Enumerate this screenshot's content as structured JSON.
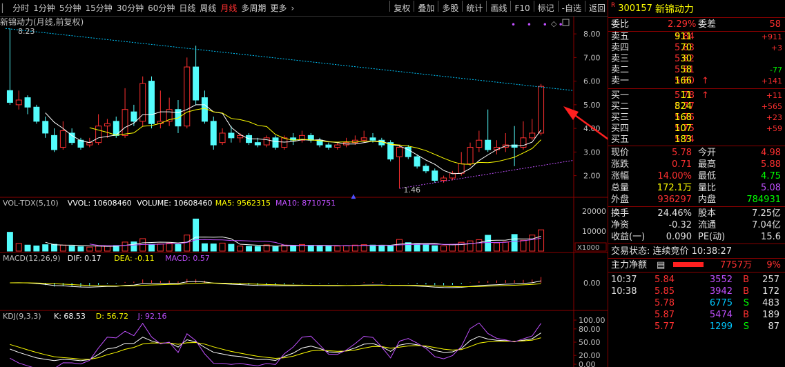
{
  "toolbar": {
    "items": [
      "分时",
      "1分钟",
      "5分钟",
      "15分钟",
      "30分钟",
      "60分钟",
      "日线",
      "周线",
      "月线",
      "多周期",
      "更多"
    ],
    "active": "月线",
    "more_arrow": "›",
    "right": [
      "复权",
      "叠加",
      "多股",
      "统计",
      "画线",
      "F10",
      "标记",
      "-自选",
      "返回"
    ]
  },
  "chart": {
    "title": "新锦动力(月线,前复权)",
    "price_axis": [
      "8.00",
      "7.00",
      "6.00",
      "5.00",
      "4.00",
      "3.00",
      "2.00"
    ],
    "high_label": "8.23",
    "low_label": "1.46",
    "vol_header": [
      "VOL-TDX(5,10)",
      "VVOL: 10608460",
      "VOLUME: 10608460",
      "MA5: 9562315",
      "MA10: 8710751"
    ],
    "vol_axis": [
      "20000",
      "10000"
    ],
    "vol_unit": "X1000",
    "macd_header": [
      "MACD(12,26,9)",
      "DIF: 0.17",
      "DEA: -0.11",
      "MACD: 0.57"
    ],
    "macd_axis": [
      "0.00"
    ],
    "kdj_header": [
      "KDJ(9,3,3)",
      "K: 68.53",
      "D: 56.72",
      "J: 92.16"
    ],
    "kdj_axis": [
      "100.00",
      "80.00",
      "50.00",
      "20.00",
      "0.00"
    ],
    "colors": {
      "up": "#ff3030",
      "down": "#54fcfc",
      "ma5": "#ffffff",
      "ma10": "#ffff00",
      "trend": "#00c8ff",
      "support": "#c050ff"
    }
  },
  "chart_data": {
    "type": "candlestick",
    "note_ignore": false,
    "candles": [
      [
        5.6,
        5.1,
        8.23,
        5.0
      ],
      [
        5.0,
        5.2,
        5.6,
        4.8
      ],
      [
        5.3,
        4.9,
        5.4,
        4.6
      ],
      [
        4.9,
        4.3,
        5.0,
        4.2
      ],
      [
        4.3,
        3.8,
        4.5,
        3.6
      ],
      [
        3.7,
        3.1,
        4.0,
        3.0
      ],
      [
        3.2,
        3.9,
        4.3,
        3.1
      ],
      [
        3.8,
        3.4,
        4.0,
        3.3
      ],
      [
        3.5,
        3.2,
        3.6,
        3.1
      ],
      [
        3.3,
        3.4,
        3.6,
        3.2
      ],
      [
        3.4,
        4.1,
        4.6,
        3.3
      ],
      [
        4.1,
        4.2,
        4.4,
        3.6
      ],
      [
        4.3,
        3.7,
        4.5,
        3.6
      ],
      [
        3.7,
        4.8,
        5.7,
        3.6
      ],
      [
        4.7,
        4.3,
        5.0,
        4.1
      ],
      [
        4.3,
        5.9,
        6.2,
        4.1
      ],
      [
        6.0,
        4.2,
        6.2,
        4.0
      ],
      [
        4.2,
        4.3,
        5.6,
        4.0
      ],
      [
        4.3,
        4.8,
        5.3,
        4.1
      ],
      [
        4.8,
        4.1,
        5.2,
        3.8
      ],
      [
        4.1,
        6.6,
        7.0,
        4.0
      ],
      [
        6.6,
        5.2,
        7.5,
        5.0
      ],
      [
        5.3,
        4.3,
        5.6,
        4.2
      ],
      [
        4.3,
        3.3,
        4.5,
        3.1
      ],
      [
        3.4,
        3.8,
        4.0,
        3.3
      ],
      [
        3.8,
        3.6,
        4.1,
        3.4
      ],
      [
        3.6,
        3.7,
        3.8,
        3.4
      ],
      [
        3.7,
        3.4,
        3.8,
        3.3
      ],
      [
        3.4,
        3.3,
        3.6,
        3.2
      ],
      [
        3.3,
        3.6,
        3.7,
        3.2
      ],
      [
        3.6,
        3.2,
        3.7,
        3.1
      ],
      [
        3.2,
        3.6,
        3.7,
        3.1
      ],
      [
        3.6,
        3.5,
        3.8,
        3.3
      ],
      [
        3.5,
        3.7,
        3.9,
        3.4
      ],
      [
        3.7,
        3.5,
        3.8,
        3.4
      ],
      [
        3.5,
        3.3,
        3.6,
        3.2
      ],
      [
        3.3,
        3.2,
        3.4,
        3.1
      ],
      [
        3.2,
        3.3,
        3.4,
        3.1
      ],
      [
        3.3,
        3.4,
        3.6,
        3.2
      ],
      [
        3.4,
        3.5,
        3.7,
        3.3
      ],
      [
        3.5,
        3.6,
        3.9,
        3.4
      ],
      [
        3.6,
        3.5,
        3.8,
        3.4
      ],
      [
        3.5,
        3.3,
        3.6,
        3.2
      ],
      [
        3.4,
        2.7,
        3.5,
        2.6
      ],
      [
        2.8,
        3.2,
        3.3,
        1.46
      ],
      [
        3.2,
        2.8,
        3.3,
        2.7
      ],
      [
        2.8,
        2.4,
        2.9,
        2.3
      ],
      [
        2.4,
        2.2,
        2.5,
        2.1
      ],
      [
        2.2,
        1.8,
        2.3,
        1.7
      ],
      [
        1.8,
        1.9,
        2.0,
        1.7
      ],
      [
        1.9,
        2.1,
        2.2,
        1.8
      ],
      [
        2.1,
        2.5,
        3.0,
        2.0
      ],
      [
        2.5,
        3.2,
        3.4,
        2.4
      ],
      [
        3.2,
        3.5,
        3.9,
        3.0
      ],
      [
        3.5,
        3.1,
        4.8,
        3.0
      ],
      [
        3.1,
        3.2,
        3.5,
        2.9
      ],
      [
        3.2,
        3.3,
        3.8,
        3.0
      ],
      [
        3.3,
        3.2,
        4.1,
        2.4
      ],
      [
        3.2,
        3.6,
        4.3,
        3.1
      ],
      [
        3.6,
        3.8,
        4.4,
        3.5
      ],
      [
        3.8,
        5.78,
        5.88,
        3.7
      ]
    ],
    "volumes": [
      9400,
      3800,
      3000,
      2600,
      3200,
      3400,
      3000,
      2500,
      2200,
      2000,
      2600,
      2600,
      2800,
      4500,
      4600,
      6200,
      3400,
      3600,
      4000,
      3300,
      8000,
      16000,
      3700,
      3600,
      4000,
      3400,
      2500,
      2400,
      2300,
      3100,
      2200,
      3000,
      2700,
      3300,
      2900,
      2600,
      2700,
      2500,
      2700,
      3000,
      3200,
      3000,
      2800,
      2600,
      5800,
      4200,
      3700,
      3200,
      2700,
      2600,
      3400,
      4400,
      5100,
      5700,
      7900,
      4100,
      4600,
      8300,
      5400,
      8000,
      10600
    ]
  },
  "quote": {
    "code": "300157",
    "name": "新锦动力",
    "r": "R",
    "weibi_label": "委比",
    "weibi": "2.29%",
    "weicha_label": "委差",
    "weicha": "58",
    "sell": [
      {
        "l": "卖五",
        "p": "5.84",
        "v": "911",
        "c": "+911"
      },
      {
        "l": "卖四",
        "p": "5.83",
        "v": "70",
        "c": "+3"
      },
      {
        "l": "卖三",
        "p": "5.82",
        "v": "30",
        "c": ""
      },
      {
        "l": "卖二",
        "p": "5.81",
        "v": "58",
        "c": "-77"
      },
      {
        "l": "卖一",
        "p": "5.80",
        "v": "166",
        "c": "+141",
        "arrow": "↑"
      }
    ],
    "buy": [
      {
        "l": "买一",
        "p": "5.78",
        "v": "11",
        "c": "+11",
        "arrow": "↑"
      },
      {
        "l": "买二",
        "p": "5.77",
        "v": "824",
        "c": "+565"
      },
      {
        "l": "买三",
        "p": "5.76",
        "v": "168",
        "c": "+23"
      },
      {
        "l": "买四",
        "p": "5.75",
        "v": "107",
        "c": "+59"
      },
      {
        "l": "买五",
        "p": "5.74",
        "v": "183",
        "c": ""
      }
    ],
    "stats": [
      [
        "现价",
        "5.78",
        "今开",
        "4.98"
      ],
      [
        "涨跌",
        "0.71",
        "最高",
        "5.88"
      ],
      [
        "涨幅",
        "14.00%",
        "最低",
        "4.75"
      ],
      [
        "总量",
        "172.1万",
        "量比",
        "5.08"
      ],
      [
        "外盘",
        "936297",
        "内盘",
        "784931"
      ]
    ],
    "stats2": [
      [
        "换手",
        "24.46%",
        "股本",
        "7.25亿"
      ],
      [
        "净资",
        "-0.32",
        "流通",
        "7.04亿"
      ],
      [
        "收益(一)",
        "0.090",
        "PE(动)",
        "15.6"
      ]
    ],
    "status": "交易状态: 连续竞价 10:38:27",
    "zl_label": "主力净额",
    "zl_icon": "▤",
    "zl_value": "7757万",
    "zl_pct": "9%",
    "ticks": [
      [
        "10:37",
        "5.84",
        "3552",
        "B",
        "257"
      ],
      [
        "10:38",
        "5.85",
        "3942",
        "B",
        "172"
      ],
      [
        "",
        "5.78",
        "6775",
        "S",
        "483"
      ],
      [
        "",
        "5.87",
        "5474",
        "B",
        "189"
      ],
      [
        "",
        "5.77",
        "1299",
        "S",
        "87"
      ]
    ]
  }
}
